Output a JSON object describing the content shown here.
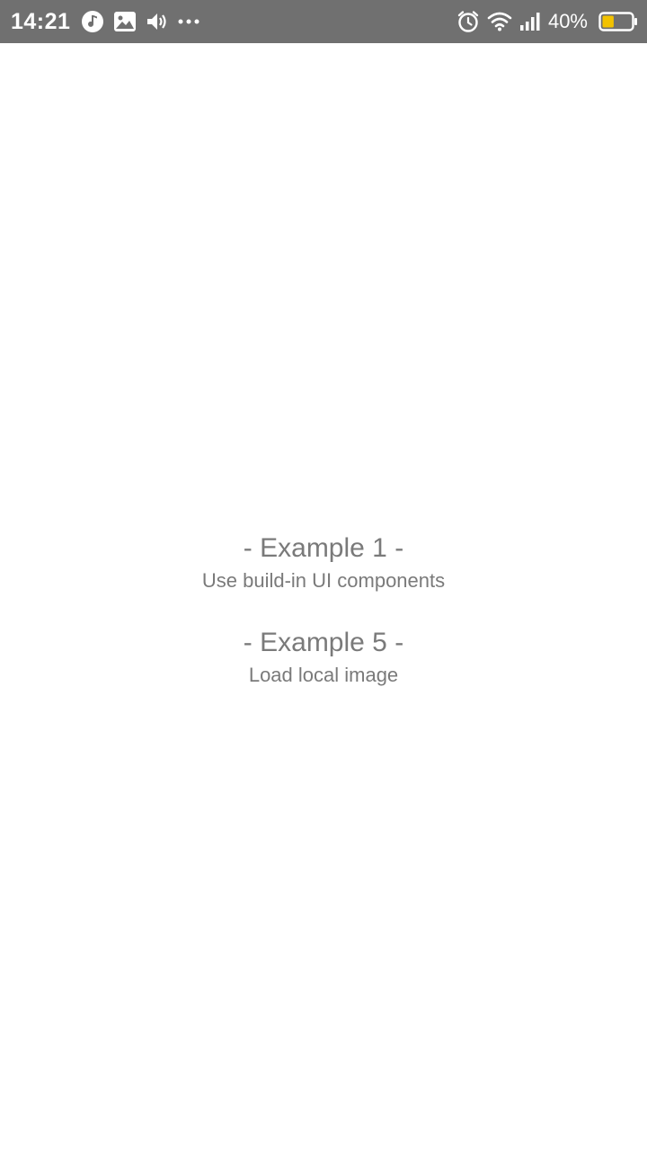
{
  "status_bar": {
    "time": "14:21",
    "battery_percent": "40%",
    "battery_level": 0.4,
    "icons_left": [
      "music-note-icon",
      "image-icon",
      "volume-icon",
      "more-dots-icon"
    ],
    "icons_right": [
      "alarm-icon",
      "wifi-icon",
      "signal-icon",
      "battery-icon"
    ],
    "colors": {
      "background": "#707070",
      "battery_fill": "#f2c200"
    }
  },
  "examples": [
    {
      "title": "- Example 1 -",
      "description": "Use build-in UI components"
    },
    {
      "title": "- Example 5 -",
      "description": "Load local image"
    }
  ],
  "colors": {
    "text": "#7a7a7a",
    "background": "#ffffff"
  }
}
